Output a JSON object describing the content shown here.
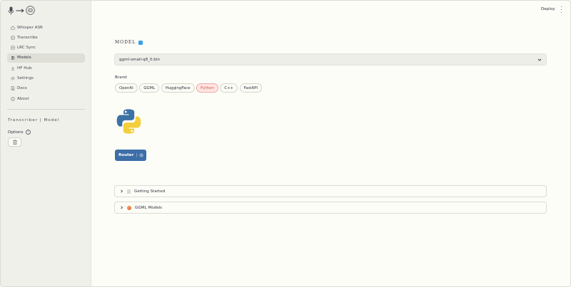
{
  "sidebar": {
    "logo_icons": [
      "microphone-icon",
      "arrow-right-icon",
      "robot-icon"
    ],
    "items": [
      {
        "label": "Whisper ASR",
        "icon": "home-icon",
        "active": false
      },
      {
        "label": "Transcribe",
        "icon": "edit-icon",
        "active": false
      },
      {
        "label": "LRC Sync",
        "icon": "sync-icon",
        "active": false
      },
      {
        "label": "Models",
        "icon": "users-icon",
        "active": true
      },
      {
        "label": "HF Hub",
        "icon": "download-icon",
        "active": false
      },
      {
        "label": "Settings",
        "icon": "gear-icon",
        "active": false
      },
      {
        "label": "Docs",
        "icon": "document-icon",
        "active": false
      },
      {
        "label": "About",
        "icon": "info-icon",
        "active": false
      }
    ],
    "section_heading": "Transcriber | Model",
    "options_label": "Options",
    "trash_icon": "trash-icon"
  },
  "header": {
    "deploy_label": "Deploy",
    "menu_icon": "kebab-menu-icon"
  },
  "main": {
    "model_label": "MODEL",
    "model_select": {
      "value": "ggml-small-q8_0.bin"
    },
    "brand_label": "Brand",
    "brands": [
      {
        "label": "OpenAI",
        "active": false
      },
      {
        "label": "GGML",
        "active": false
      },
      {
        "label": "HuggingFace",
        "active": false
      },
      {
        "label": "Python",
        "active": true
      },
      {
        "label": "C++",
        "active": false
      },
      {
        "label": "FastAPI",
        "active": false
      }
    ],
    "router_label": "Router",
    "router_separator": "|",
    "expanders": [
      {
        "label": "Getting Started",
        "icon": "document-icon"
      },
      {
        "label": "GGML Models",
        "icon": "ball-icon"
      }
    ]
  },
  "colors": {
    "accent": "#e0504a",
    "router_bg": "#3c6ea8",
    "sidebar_bg": "#f0f0ea",
    "main_bg": "#fdfdf8"
  }
}
